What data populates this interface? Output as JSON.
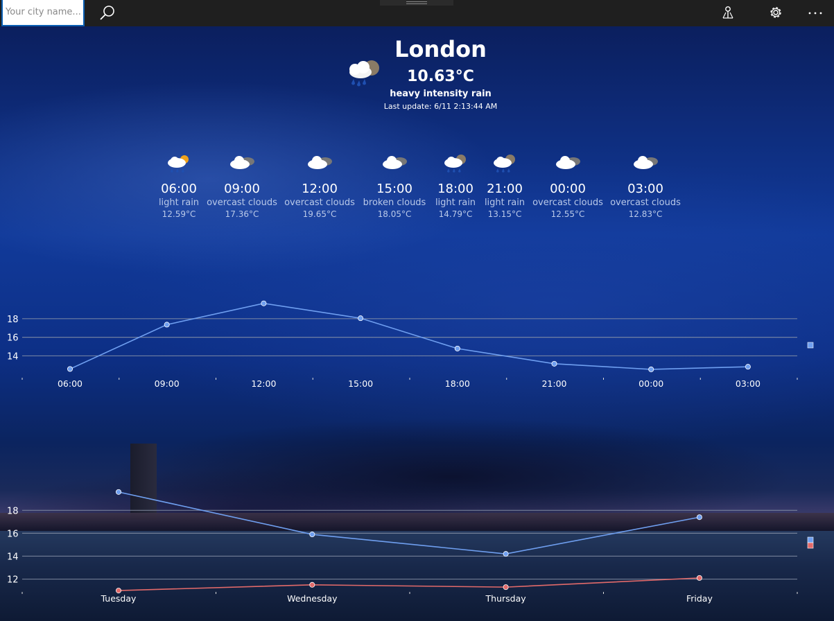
{
  "search": {
    "placeholder": "Your city name..."
  },
  "icons": {
    "search": "search-icon",
    "pin": "pin-icon",
    "settings": "gear-icon",
    "more": "more-icon"
  },
  "current": {
    "city": "London",
    "temperature": "10.63°C",
    "description": "heavy intensity rain",
    "last_update": "Last update: 6/11 2:13:44 AM",
    "icon": "rain-cloud-moon-icon"
  },
  "forecast": [
    {
      "time": "06:00",
      "description": "light rain",
      "temperature": "12.59°C",
      "icon": "rain-sun-icon"
    },
    {
      "time": "09:00",
      "description": "overcast clouds",
      "temperature": "17.36°C",
      "icon": "overcast-icon"
    },
    {
      "time": "12:00",
      "description": "overcast clouds",
      "temperature": "19.65°C",
      "icon": "overcast-icon"
    },
    {
      "time": "15:00",
      "description": "broken clouds",
      "temperature": "18.05°C",
      "icon": "overcast-icon"
    },
    {
      "time": "18:00",
      "description": "light rain",
      "temperature": "14.79°C",
      "icon": "rain-moon-icon"
    },
    {
      "time": "21:00",
      "description": "light rain",
      "temperature": "13.15°C",
      "icon": "rain-moon-icon"
    },
    {
      "time": "00:00",
      "description": "overcast clouds",
      "temperature": "12.55°C",
      "icon": "overcast-icon"
    },
    {
      "time": "03:00",
      "description": "overcast clouds",
      "temperature": "12.83°C",
      "icon": "overcast-icon"
    }
  ],
  "colors": {
    "series_high": "#6f9ff0",
    "series_low": "#e36a6a",
    "grid": "#8a93a8"
  },
  "chart_data": [
    {
      "type": "line",
      "categories": [
        "06:00",
        "09:00",
        "12:00",
        "15:00",
        "18:00",
        "21:00",
        "00:00",
        "03:00"
      ],
      "series": [
        {
          "values": [
            12.59,
            17.36,
            19.65,
            18.05,
            14.79,
            13.15,
            12.55,
            12.83
          ]
        }
      ],
      "yticks": [
        14,
        16,
        18
      ],
      "ylim": [
        11.2,
        20.0
      ],
      "grid": true,
      "legend": "right"
    },
    {
      "type": "line",
      "categories": [
        "Tuesday",
        "Wednesday",
        "Thursday",
        "Friday"
      ],
      "series": [
        {
          "values": [
            19.6,
            15.9,
            14.2,
            17.4
          ]
        },
        {
          "values": [
            11.0,
            11.5,
            11.3,
            12.1
          ]
        }
      ],
      "yticks": [
        12,
        14,
        16,
        18
      ],
      "ylim": [
        10.4,
        20.8
      ],
      "grid": true,
      "legend": "right"
    }
  ]
}
